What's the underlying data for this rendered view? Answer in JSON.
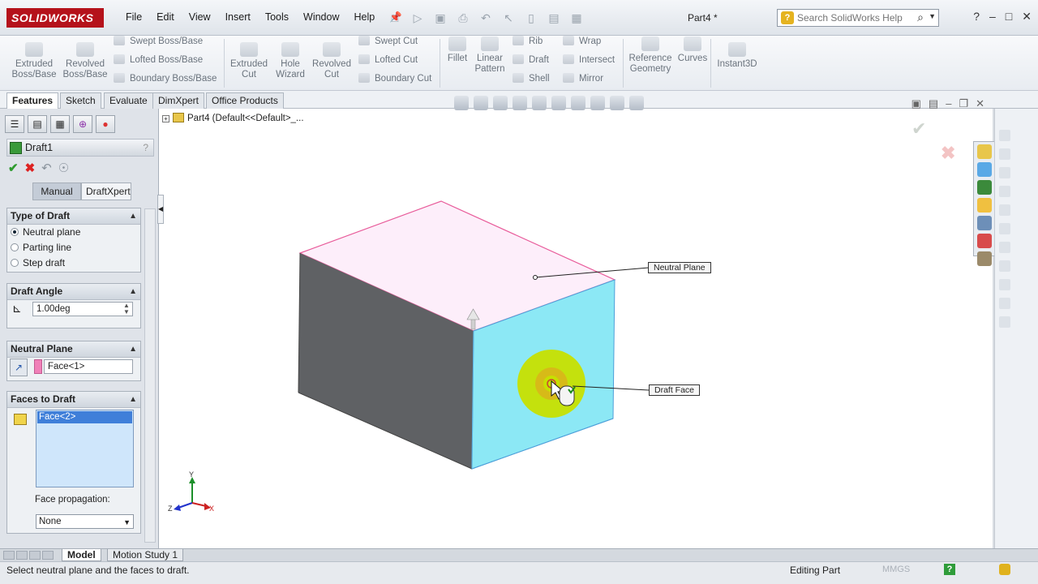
{
  "app": {
    "logo_text": "SOLIDWORKS",
    "document_title": "Part4 *",
    "menus": [
      "File",
      "Edit",
      "View",
      "Insert",
      "Tools",
      "Window",
      "Help"
    ],
    "help_search_placeholder": "Search SolidWorks Help"
  },
  "ribbon": {
    "extruded_boss": "Extruded Boss/Base",
    "revolved_boss": "Revolved Boss/Base",
    "swept_boss": "Swept Boss/Base",
    "lofted_boss": "Lofted Boss/Base",
    "boundary_boss": "Boundary Boss/Base",
    "extruded_cut": "Extruded Cut",
    "hole_wizard": "Hole Wizard",
    "revolved_cut": "Revolved Cut",
    "swept_cut": "Swept Cut",
    "lofted_cut": "Lofted Cut",
    "boundary_cut": "Boundary Cut",
    "fillet": "Fillet",
    "linear_pattern": "Linear Pattern",
    "rib": "Rib",
    "draft": "Draft",
    "shell": "Shell",
    "wrap": "Wrap",
    "intersect": "Intersect",
    "mirror": "Mirror",
    "reference_geometry": "Reference Geometry",
    "curves": "Curves",
    "instant3d": "Instant3D"
  },
  "tabs": [
    "Features",
    "Sketch",
    "Evaluate",
    "DimXpert",
    "Office Products"
  ],
  "property_manager": {
    "title": "Draft1",
    "help": "?",
    "modes": [
      "Manual",
      "DraftXpert"
    ],
    "type_of_draft": {
      "header": "Type of Draft",
      "options": [
        "Neutral plane",
        "Parting line",
        "Step draft"
      ]
    },
    "draft_angle": {
      "header": "Draft Angle",
      "value": "1.00deg"
    },
    "neutral_plane": {
      "header": "Neutral Plane",
      "value": "Face<1>"
    },
    "faces_to_draft": {
      "header": "Faces to Draft",
      "items": [
        "Face<2>"
      ],
      "propagation_label": "Face propagation:",
      "propagation_value": "None"
    }
  },
  "graphics": {
    "tree_label": "Part4  (Default<<Default>_...",
    "callout_neutral": "Neutral Plane",
    "callout_draft": "Draft Face",
    "triad_y": "Y",
    "triad_z": "Z",
    "triad_x": "X"
  },
  "bottom_tabs": [
    "Model",
    "Motion Study 1"
  ],
  "status": {
    "message": "Select neutral plane and the faces to draft.",
    "mode": "Editing Part",
    "units": "MMGS"
  },
  "colors": {
    "top_face": "#fdeefa",
    "front_face": "#5f6164",
    "right_face": "#8ce8f5",
    "highlight_edge": "#e85b9a",
    "accent_brand": "#b5121b"
  }
}
